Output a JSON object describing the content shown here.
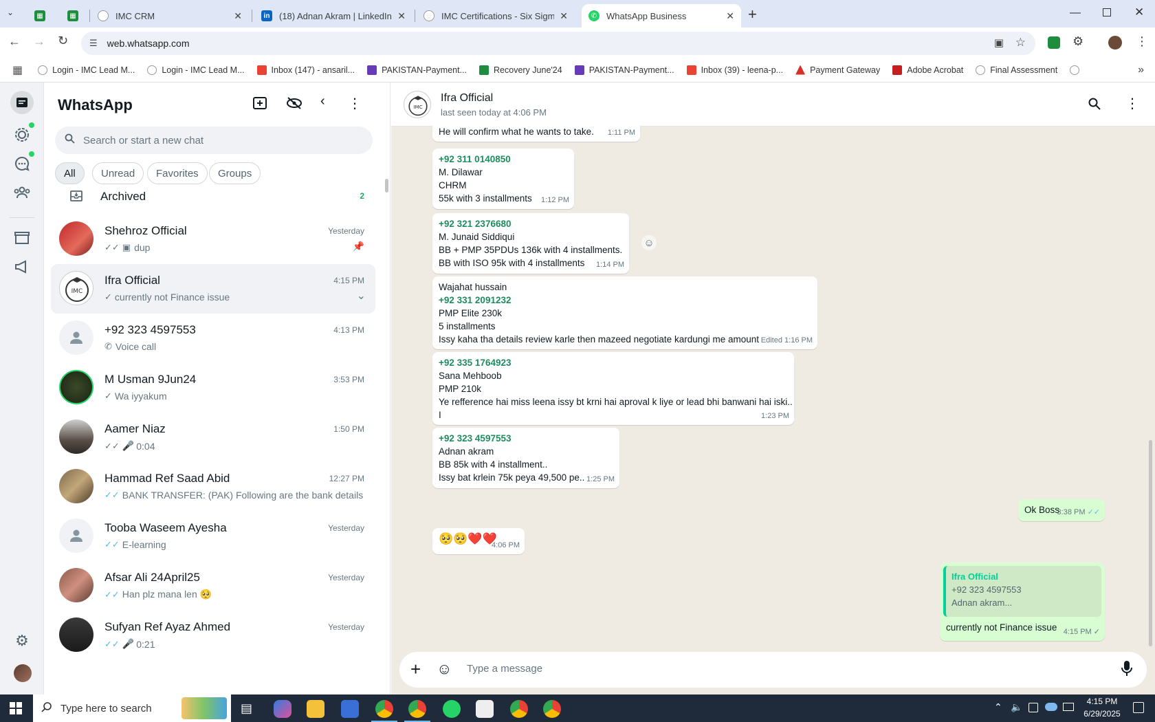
{
  "browser": {
    "tabs": [
      {
        "title": "",
        "icon": "sheets-icon"
      },
      {
        "title": "",
        "icon": "sheets-icon"
      },
      {
        "title": "IMC CRM",
        "icon": "imc-icon"
      },
      {
        "title": "(18) Adnan Akram | LinkedIn",
        "icon": "linkedin-icon"
      },
      {
        "title": "IMC Certifications - Six Sigma G",
        "icon": "imc-icon"
      },
      {
        "title": "WhatsApp Business",
        "icon": "whatsapp-icon"
      }
    ],
    "url": "web.whatsapp.com",
    "bookmarks": [
      "Login - IMC Lead M...",
      "Login - IMC Lead M...",
      "Inbox (147) - ansaril...",
      "PAKISTAN-Payment...",
      "Recovery June'24",
      "PAKISTAN-Payment...",
      "Inbox (39) - leena-p...",
      "Payment Gateway",
      "Adobe Acrobat",
      "Final Assessment"
    ]
  },
  "sidebar": {
    "title": "WhatsApp",
    "search_placeholder": "Search or start a new chat",
    "filters": [
      "All",
      "Unread",
      "Favorites",
      "Groups"
    ],
    "archived": {
      "label": "Archived",
      "count": "2"
    },
    "chats": [
      {
        "name": "Shehroz Official",
        "time": "Yesterday",
        "preview": "dup"
      },
      {
        "name": "Ifra Official",
        "time": "4:15 PM",
        "preview": "currently not Finance issue"
      },
      {
        "name": "+92 323 4597553",
        "time": "4:13 PM",
        "preview": "Voice call"
      },
      {
        "name": "M Usman 9Jun24",
        "time": "3:53 PM",
        "preview": "Wa iyyakum"
      },
      {
        "name": "Aamer Niaz",
        "time": "1:50 PM",
        "preview": "0:04"
      },
      {
        "name": "Hammad Ref Saad Abid",
        "time": "12:27 PM",
        "preview": "BANK TRANSFER: (PAK) Following are the bank details f..."
      },
      {
        "name": "Tooba Waseem Ayesha",
        "time": "Yesterday",
        "preview": "E-learning"
      },
      {
        "name": "Afsar Ali 24April25",
        "time": "Yesterday",
        "preview": "Han plz mana len 🥺"
      },
      {
        "name": "Sufyan Ref Ayaz Ahmed",
        "time": "Yesterday",
        "preview": "0:21"
      }
    ]
  },
  "conversation": {
    "contact": "Ifra Official",
    "status": "last seen today at 4:06 PM",
    "messages": [
      {
        "lines": [
          "He will confirm what he wants to take."
        ],
        "time": "1:11 PM"
      },
      {
        "phone": "+92 311 0140850",
        "lines": [
          "M. Dilawar",
          "CHRM",
          "55k with 3 installments"
        ],
        "time": "1:12 PM"
      },
      {
        "phone": "+92 321 2376680",
        "lines": [
          "M. Junaid Siddiqui",
          "BB + PMP 35PDUs 136k with 4 installments.",
          "BB with ISO 95k with 4 installments"
        ],
        "time": "1:14 PM"
      },
      {
        "lines_before": [
          "Wajahat hussain"
        ],
        "phone": "+92 331 2091232",
        "lines": [
          "PMP Elite 230k",
          "5 installments",
          "Issy kaha tha details review karle then mazeed negotiate kardungi me amount"
        ],
        "time": "Edited 1:16 PM"
      },
      {
        "phone": "+92 335 1764923",
        "lines": [
          "Sana Mehboob",
          "PMP 210k",
          "Ye refference hai miss leena issy bt krni hai aproval k liye or lead bhi banwani hai iski..",
          "I"
        ],
        "time": "1:23 PM"
      },
      {
        "phone": "+92 323 4597553",
        "lines": [
          "Adnan akram",
          "BB 85k with 4 installment..",
          "Issy bat krlein 75k peya 49,500 pe.."
        ],
        "time": "1:25 PM"
      },
      {
        "lines": [
          "Ok Boss"
        ],
        "time": "3:38 PM"
      },
      {
        "lines": [
          "🥺🥺❤️❤️"
        ],
        "time": "4:06 PM"
      },
      {
        "quote_name": "Ifra Official",
        "quote_lines": [
          "+92 323 4597553",
          "Adnan akram..."
        ],
        "lines": [
          "currently not Finance issue"
        ],
        "time": "4:15 PM"
      }
    ],
    "composer_placeholder": "Type a message"
  },
  "taskbar": {
    "search_placeholder": "Type here to search",
    "time": "4:15 PM",
    "date": "6/29/2025"
  }
}
